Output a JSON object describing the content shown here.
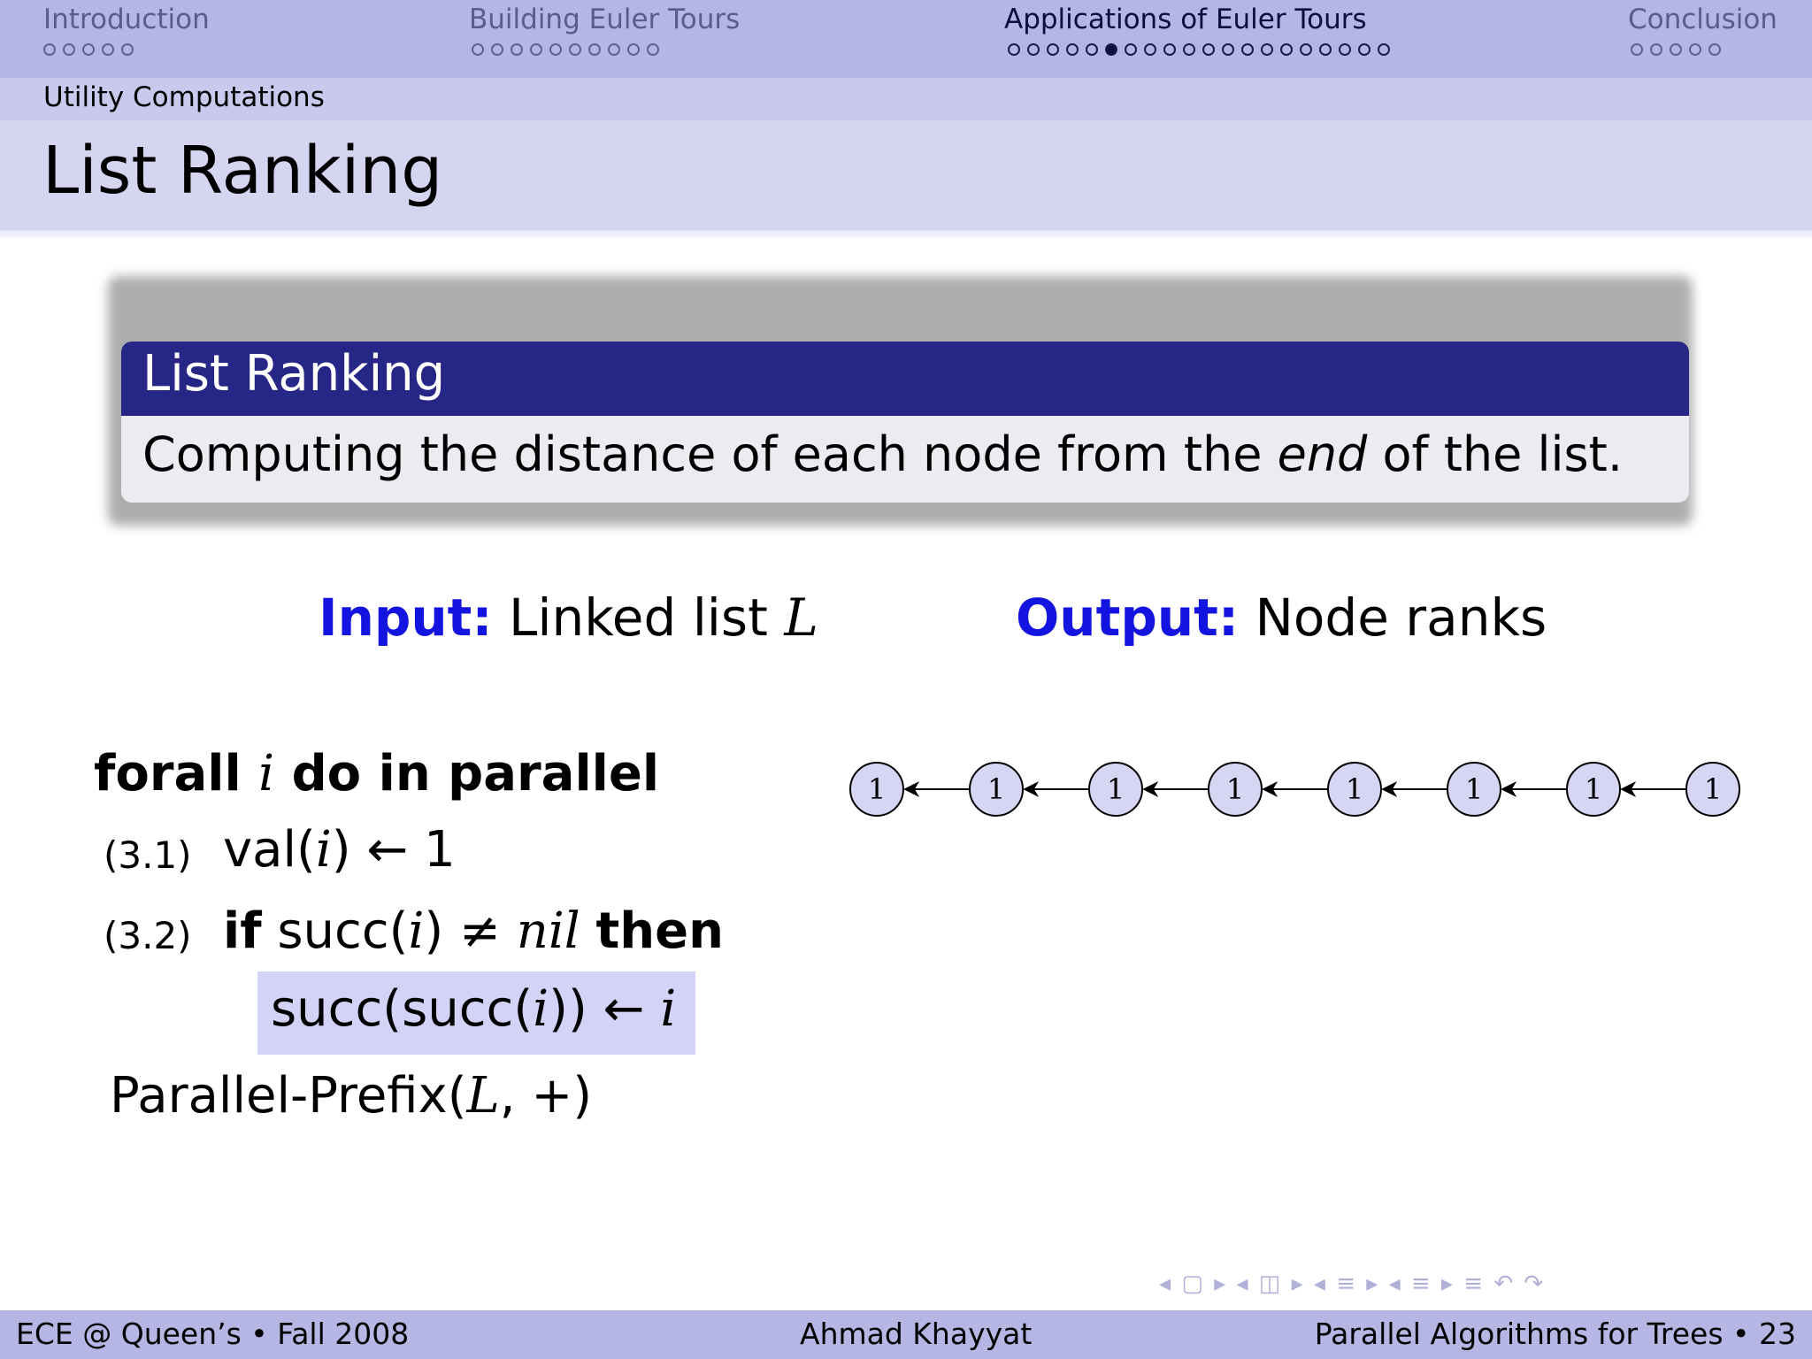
{
  "nav": {
    "sections": [
      {
        "label": "Introduction",
        "dots": 5,
        "filled_index": -1,
        "active": false
      },
      {
        "label": "Building Euler Tours",
        "dots": 10,
        "filled_index": -1,
        "active": false
      },
      {
        "label": "Applications of Euler Tours",
        "dots": 20,
        "filled_index": 5,
        "active": true
      },
      {
        "label": "Conclusion",
        "dots": 5,
        "filled_index": -1,
        "active": false
      }
    ],
    "subsection": "Utility Computations"
  },
  "frame": {
    "title": "List Ranking"
  },
  "block": {
    "title": "List Ranking",
    "body_before": "Computing the distance of each node from the ",
    "body_emph": "end",
    "body_after": " of the list."
  },
  "io": {
    "input_label": "Input:",
    "input_text": "Linked list ",
    "input_var": "L",
    "output_label": "Output:",
    "output_text": "Node ranks"
  },
  "algorithm": {
    "header_kw1": "forall",
    "header_var": "i",
    "header_kw2": "do in parallel",
    "step1_num": "(3.1)",
    "step1_pre": "val(",
    "step1_var": "i",
    "step1_post": ") ← 1",
    "step2_num": "(3.2)",
    "step2_if": "if",
    "step2_pre": " succ(",
    "step2_var": "i",
    "step2_mid": ") ≠ ",
    "step2_nil": "nil",
    "step2_then": "then",
    "step2b_pre": "succ(succ(",
    "step2b_var": "i",
    "step2b_post": ")) ← ",
    "step2b_var2": "i",
    "final_pre": "Parallel-Prefix(",
    "final_var": "L",
    "final_post": ", +)"
  },
  "list_nodes": [
    "1",
    "1",
    "1",
    "1",
    "1",
    "1",
    "1",
    "1"
  ],
  "footer": {
    "left": "ECE @ Queen’s • Fall 2008",
    "center": "Ahmad Khayyat",
    "right": "Parallel Algorithms for Trees • 23"
  },
  "beamer_nav_symbols": "◂ ▢ ▸  ◂ ◫ ▸  ◂ ≡ ▸  ◂ ≡ ▸   ≡   ↶ ↷"
}
